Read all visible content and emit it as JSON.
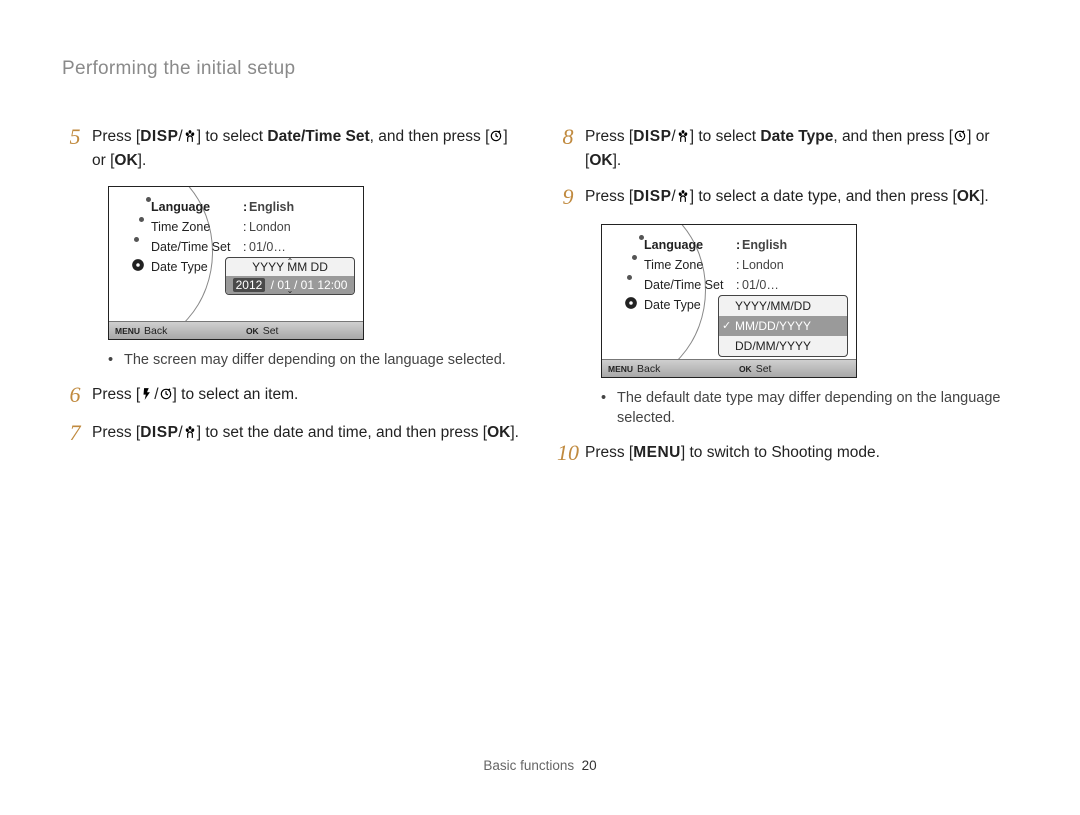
{
  "header": {
    "title": "Performing the initial setup"
  },
  "icons": {
    "disp": "DISP",
    "ok": "OK",
    "menu": "MENU"
  },
  "steps": {
    "s5": {
      "num": "5",
      "t1": "Press [",
      "t2": "] to select ",
      "bold": "Date/Time Set",
      "t3": ", and then press [",
      "t4": "] or [",
      "t5": "]."
    },
    "s6": {
      "num": "6",
      "t1": "Press [",
      "t2": "] to select an item."
    },
    "s7": {
      "num": "7",
      "t1": "Press [",
      "t2": "] to set the date and time, and then press [",
      "t3": "]."
    },
    "s8": {
      "num": "8",
      "t1": "Press [",
      "t2": "] to select ",
      "bold": "Date Type",
      "t3": ", and then press [",
      "t4": "] or [",
      "t5": "]."
    },
    "s9": {
      "num": "9",
      "t1": "Press [",
      "t2": "] to select a date type, and then press [",
      "t3": "]."
    },
    "s10": {
      "num": "10",
      "t1": "Press [",
      "t2": "] to switch to Shooting mode."
    }
  },
  "notes": {
    "n1": "The screen may differ depending on the language selected.",
    "n2": "The default date type may differ depending on the language selected."
  },
  "lcd": {
    "rows": {
      "language": {
        "label": "Language",
        "value": "English"
      },
      "timezone": {
        "label": "Time Zone",
        "value": "London"
      },
      "datetime": {
        "label": "Date/Time Set",
        "value": "01/0…"
      },
      "datetype": {
        "label": "Date Type"
      }
    },
    "datepopup": {
      "header": "YYYY  MM  DD",
      "year": "2012",
      "rest": " / 01 / 01 12:00"
    },
    "typepopup": {
      "opt1": "YYYY/MM/DD",
      "opt2": "MM/DD/YYYY",
      "opt3": "DD/MM/YYYY"
    },
    "foot": {
      "back": "Back",
      "set": "Set"
    }
  },
  "footer": {
    "section": "Basic functions",
    "page": "20"
  }
}
